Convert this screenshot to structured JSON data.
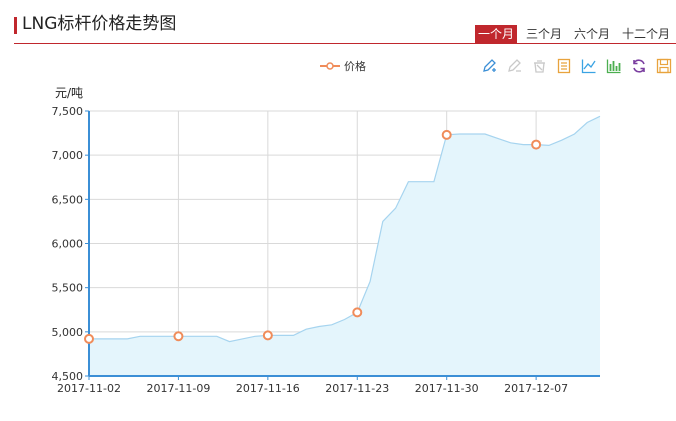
{
  "header": {
    "title": "LNG标杆价格走势图",
    "tabs": [
      {
        "label": "一个月",
        "active": true
      },
      {
        "label": "三个月",
        "active": false
      },
      {
        "label": "六个月",
        "active": false
      },
      {
        "label": "十二个月",
        "active": false
      }
    ]
  },
  "toolbox": {
    "icons": [
      {
        "name": "mark-pen-icon",
        "color": "#3b8fd6"
      },
      {
        "name": "mark-undo-icon",
        "color": "#c9c9c9"
      },
      {
        "name": "mark-clear-icon",
        "color": "#c9c9c9"
      },
      {
        "name": "data-view-icon",
        "color": "#e8a33d"
      },
      {
        "name": "line-chart-icon",
        "color": "#3aa3e3"
      },
      {
        "name": "bar-chart-icon",
        "color": "#4caf50"
      },
      {
        "name": "restore-icon",
        "color": "#7b3fa0"
      },
      {
        "name": "save-image-icon",
        "color": "#e8a33d"
      }
    ]
  },
  "colors": {
    "accent": "#c0272d",
    "line": "#a6d4ef",
    "area": "#e4f5fc",
    "marker": "#f08c5a",
    "axis": "#3b8fd6",
    "grid": "#d9d9d9"
  },
  "chart_data": {
    "type": "area",
    "ylabel": "元/吨",
    "ylim": [
      4500,
      7500
    ],
    "yticks": [
      "4,500",
      "5,000",
      "5,500",
      "6,000",
      "6,500",
      "7,000",
      "7,500"
    ],
    "xticks": [
      "2017-11-02",
      "2017-11-09",
      "2017-11-16",
      "2017-11-23",
      "2017-11-30",
      "2017-12-07"
    ],
    "grid": true,
    "legend_position": "top-center",
    "series": [
      {
        "name": "价格",
        "x": [
          "2017-11-02",
          "2017-11-03",
          "2017-11-04",
          "2017-11-05",
          "2017-11-06",
          "2017-11-07",
          "2017-11-08",
          "2017-11-09",
          "2017-11-10",
          "2017-11-11",
          "2017-11-12",
          "2017-11-13",
          "2017-11-14",
          "2017-11-15",
          "2017-11-16",
          "2017-11-17",
          "2017-11-18",
          "2017-11-19",
          "2017-11-20",
          "2017-11-21",
          "2017-11-22",
          "2017-11-23",
          "2017-11-24",
          "2017-11-25",
          "2017-11-26",
          "2017-11-27",
          "2017-11-28",
          "2017-11-29",
          "2017-11-30",
          "2017-12-01",
          "2017-12-02",
          "2017-12-03",
          "2017-12-04",
          "2017-12-05",
          "2017-12-06",
          "2017-12-07",
          "2017-12-08",
          "2017-12-09",
          "2017-12-10",
          "2017-12-11",
          "2017-12-12"
        ],
        "values": [
          4920,
          4920,
          4920,
          4920,
          4950,
          4950,
          4950,
          4950,
          4950,
          4950,
          4950,
          4890,
          4920,
          4950,
          4960,
          4960,
          4960,
          5030,
          5060,
          5080,
          5140,
          5220,
          5570,
          6250,
          6400,
          6700,
          6700,
          6700,
          7230,
          7240,
          7240,
          7240,
          7190,
          7140,
          7120,
          7120,
          7110,
          7170,
          7240,
          7370,
          7440
        ],
        "markers": [
          "2017-11-02",
          "2017-11-09",
          "2017-11-16",
          "2017-11-23",
          "2017-11-30",
          "2017-12-07"
        ]
      }
    ]
  }
}
